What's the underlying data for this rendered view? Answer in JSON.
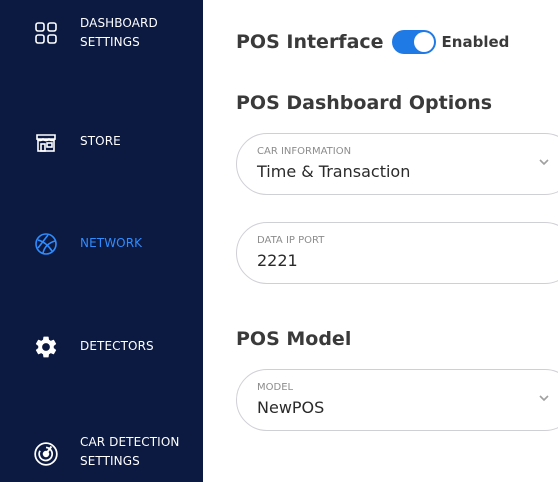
{
  "sidebar": {
    "items": [
      {
        "label": "DASHBOARD\nSETTINGS",
        "icon": "dashboard-icon",
        "active": false
      },
      {
        "label": "STORE",
        "icon": "store-icon",
        "active": false
      },
      {
        "label": "NETWORK",
        "icon": "network-icon",
        "active": true
      },
      {
        "label": "DETECTORS",
        "icon": "gear-icon",
        "active": false
      },
      {
        "label": "CAR DETECTION\nSETTINGS",
        "icon": "radar-icon",
        "active": false
      }
    ],
    "colors": {
      "background": "#0c1a42",
      "text": "#ffffff",
      "active": "#2f8cff"
    }
  },
  "pos_interface": {
    "title": "POS Interface",
    "toggle_label": "Enabled",
    "enabled": true,
    "toggle_color": "#1f7ae6"
  },
  "dashboard_options": {
    "title": "POS Dashboard Options",
    "car_information": {
      "label": "CAR INFORMATION",
      "value": "Time & Transaction"
    },
    "data_ip_port": {
      "label": "DATA IP PORT",
      "value": "2221"
    }
  },
  "pos_model": {
    "title": "POS Model",
    "model": {
      "label": "MODEL",
      "value": "NewPOS"
    }
  }
}
